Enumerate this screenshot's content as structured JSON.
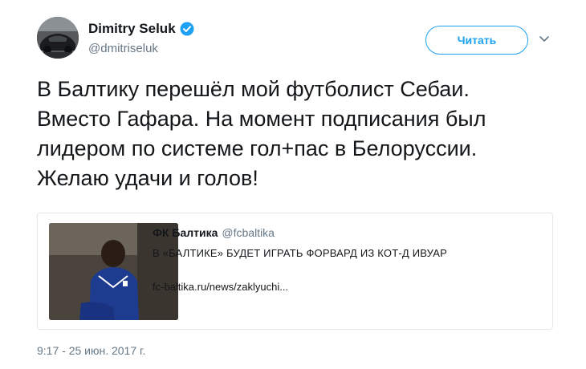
{
  "author": {
    "display_name": "Dimitry Seluk",
    "handle": "@dmitriseluk",
    "verified": true,
    "avatar_icon": "profile-photo-car"
  },
  "actions": {
    "follow_label": "Читать",
    "menu_icon": "chevron-down-icon"
  },
  "tweet": {
    "lines": [
      "В Балтику перешёл мой футболист Себаи.",
      "Вместо Гафара. На момент подписания был",
      "лидером по системе гол+пас в Белоруссии.",
      "Желаю удачи и голов!"
    ],
    "timestamp": "9:17 - 25 июн. 2017 г."
  },
  "quote": {
    "name": "ФК Балтика",
    "handle": "@fcbaltika",
    "title": "В «БАЛТИКЕ» БУДЕТ ИГРАТЬ ФОРВАРД ИЗ КОТ-Д ИВУАР",
    "link": "fc-baltika.ru/news/zaklyuchi..."
  },
  "colors": {
    "accent": "#1da1f2",
    "text": "#14171a",
    "secondary": "#657786",
    "border": "#e1e8ed"
  }
}
